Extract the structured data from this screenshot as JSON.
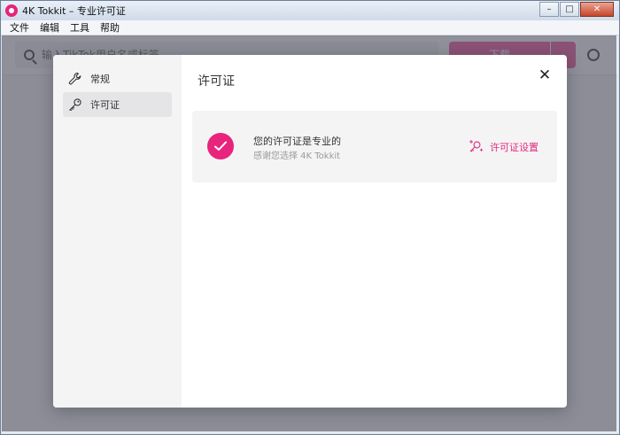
{
  "window": {
    "title": "4K Tokkit – 专业许可证",
    "controls": {
      "minimize": "–",
      "maximize": "□",
      "close": "✕"
    }
  },
  "menu": [
    "文件",
    "编辑",
    "工具",
    "帮助"
  ],
  "toolbar": {
    "search_placeholder": "输入TikTok用户名或标签",
    "download_label": "下载",
    "dropdown_glyph": "⌄"
  },
  "dialog": {
    "nav": [
      {
        "label": "常规",
        "icon": "wrench-icon"
      },
      {
        "label": "许可证",
        "icon": "key-icon"
      }
    ],
    "active_nav": "许可证",
    "title": "许可证",
    "close_glyph": "✕",
    "license": {
      "status": "您的许可证是专业的",
      "thanks": "感谢您选择 4K Tokkit",
      "settings_label": "许可证设置"
    }
  },
  "colors": {
    "accent": "#e8247d",
    "sidebar_bg": "#f4f4f5",
    "card_bg": "#f4f4f5"
  }
}
